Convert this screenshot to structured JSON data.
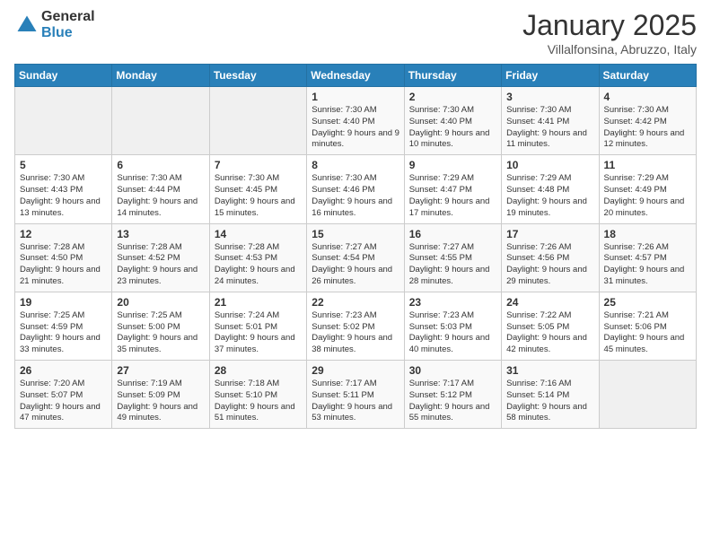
{
  "header": {
    "logo_general": "General",
    "logo_blue": "Blue",
    "month": "January 2025",
    "location": "Villalfonsina, Abruzzo, Italy"
  },
  "weekdays": [
    "Sunday",
    "Monday",
    "Tuesday",
    "Wednesday",
    "Thursday",
    "Friday",
    "Saturday"
  ],
  "weeks": [
    [
      {
        "day": "",
        "info": ""
      },
      {
        "day": "",
        "info": ""
      },
      {
        "day": "",
        "info": ""
      },
      {
        "day": "1",
        "info": "Sunrise: 7:30 AM\nSunset: 4:40 PM\nDaylight: 9 hours and 9 minutes."
      },
      {
        "day": "2",
        "info": "Sunrise: 7:30 AM\nSunset: 4:40 PM\nDaylight: 9 hours and 10 minutes."
      },
      {
        "day": "3",
        "info": "Sunrise: 7:30 AM\nSunset: 4:41 PM\nDaylight: 9 hours and 11 minutes."
      },
      {
        "day": "4",
        "info": "Sunrise: 7:30 AM\nSunset: 4:42 PM\nDaylight: 9 hours and 12 minutes."
      }
    ],
    [
      {
        "day": "5",
        "info": "Sunrise: 7:30 AM\nSunset: 4:43 PM\nDaylight: 9 hours and 13 minutes."
      },
      {
        "day": "6",
        "info": "Sunrise: 7:30 AM\nSunset: 4:44 PM\nDaylight: 9 hours and 14 minutes."
      },
      {
        "day": "7",
        "info": "Sunrise: 7:30 AM\nSunset: 4:45 PM\nDaylight: 9 hours and 15 minutes."
      },
      {
        "day": "8",
        "info": "Sunrise: 7:30 AM\nSunset: 4:46 PM\nDaylight: 9 hours and 16 minutes."
      },
      {
        "day": "9",
        "info": "Sunrise: 7:29 AM\nSunset: 4:47 PM\nDaylight: 9 hours and 17 minutes."
      },
      {
        "day": "10",
        "info": "Sunrise: 7:29 AM\nSunset: 4:48 PM\nDaylight: 9 hours and 19 minutes."
      },
      {
        "day": "11",
        "info": "Sunrise: 7:29 AM\nSunset: 4:49 PM\nDaylight: 9 hours and 20 minutes."
      }
    ],
    [
      {
        "day": "12",
        "info": "Sunrise: 7:28 AM\nSunset: 4:50 PM\nDaylight: 9 hours and 21 minutes."
      },
      {
        "day": "13",
        "info": "Sunrise: 7:28 AM\nSunset: 4:52 PM\nDaylight: 9 hours and 23 minutes."
      },
      {
        "day": "14",
        "info": "Sunrise: 7:28 AM\nSunset: 4:53 PM\nDaylight: 9 hours and 24 minutes."
      },
      {
        "day": "15",
        "info": "Sunrise: 7:27 AM\nSunset: 4:54 PM\nDaylight: 9 hours and 26 minutes."
      },
      {
        "day": "16",
        "info": "Sunrise: 7:27 AM\nSunset: 4:55 PM\nDaylight: 9 hours and 28 minutes."
      },
      {
        "day": "17",
        "info": "Sunrise: 7:26 AM\nSunset: 4:56 PM\nDaylight: 9 hours and 29 minutes."
      },
      {
        "day": "18",
        "info": "Sunrise: 7:26 AM\nSunset: 4:57 PM\nDaylight: 9 hours and 31 minutes."
      }
    ],
    [
      {
        "day": "19",
        "info": "Sunrise: 7:25 AM\nSunset: 4:59 PM\nDaylight: 9 hours and 33 minutes."
      },
      {
        "day": "20",
        "info": "Sunrise: 7:25 AM\nSunset: 5:00 PM\nDaylight: 9 hours and 35 minutes."
      },
      {
        "day": "21",
        "info": "Sunrise: 7:24 AM\nSunset: 5:01 PM\nDaylight: 9 hours and 37 minutes."
      },
      {
        "day": "22",
        "info": "Sunrise: 7:23 AM\nSunset: 5:02 PM\nDaylight: 9 hours and 38 minutes."
      },
      {
        "day": "23",
        "info": "Sunrise: 7:23 AM\nSunset: 5:03 PM\nDaylight: 9 hours and 40 minutes."
      },
      {
        "day": "24",
        "info": "Sunrise: 7:22 AM\nSunset: 5:05 PM\nDaylight: 9 hours and 42 minutes."
      },
      {
        "day": "25",
        "info": "Sunrise: 7:21 AM\nSunset: 5:06 PM\nDaylight: 9 hours and 45 minutes."
      }
    ],
    [
      {
        "day": "26",
        "info": "Sunrise: 7:20 AM\nSunset: 5:07 PM\nDaylight: 9 hours and 47 minutes."
      },
      {
        "day": "27",
        "info": "Sunrise: 7:19 AM\nSunset: 5:09 PM\nDaylight: 9 hours and 49 minutes."
      },
      {
        "day": "28",
        "info": "Sunrise: 7:18 AM\nSunset: 5:10 PM\nDaylight: 9 hours and 51 minutes."
      },
      {
        "day": "29",
        "info": "Sunrise: 7:17 AM\nSunset: 5:11 PM\nDaylight: 9 hours and 53 minutes."
      },
      {
        "day": "30",
        "info": "Sunrise: 7:17 AM\nSunset: 5:12 PM\nDaylight: 9 hours and 55 minutes."
      },
      {
        "day": "31",
        "info": "Sunrise: 7:16 AM\nSunset: 5:14 PM\nDaylight: 9 hours and 58 minutes."
      },
      {
        "day": "",
        "info": ""
      }
    ]
  ]
}
